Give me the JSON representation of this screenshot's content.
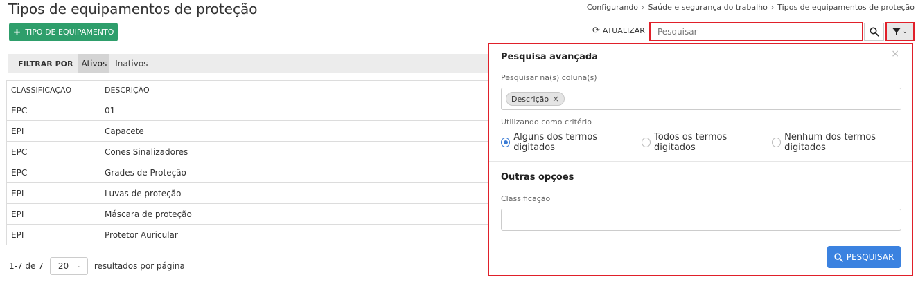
{
  "page": {
    "title": "Tipos de equipamentos de proteção",
    "breadcrumb": [
      "Configurando",
      "Saúde e segurança do trabalho",
      "Tipos de equipamentos de proteção"
    ]
  },
  "toolbar": {
    "add_label": "TIPO DE EQUIPAMENTO",
    "refresh_label": "ATUALIZAR",
    "search_placeholder": "Pesquisar"
  },
  "filter": {
    "label": "FILTRAR POR",
    "options": [
      "Ativos",
      "Inativos"
    ],
    "active": "Ativos"
  },
  "table": {
    "columns": [
      "CLASSIFICAÇÃO",
      "DESCRIÇÃO"
    ],
    "rows": [
      [
        "EPC",
        "01"
      ],
      [
        "EPI",
        "Capacete"
      ],
      [
        "EPC",
        "Cones Sinalizadores"
      ],
      [
        "EPC",
        "Grades de Proteção"
      ],
      [
        "EPI",
        "Luvas de proteção"
      ],
      [
        "EPI",
        "Máscara de proteção"
      ],
      [
        "EPI",
        "Protetor Auricular"
      ]
    ]
  },
  "pager": {
    "range": "1-7 de 7",
    "page_size": "20",
    "suffix": "resultados por página"
  },
  "advanced": {
    "title": "Pesquisa avançada",
    "columns_label": "Pesquisar na(s) coluna(s)",
    "selected_tag": "Descrição",
    "criteria_label": "Utilizando como critério",
    "criteria": [
      "Alguns dos termos digitados",
      "Todos os termos digitados",
      "Nenhum dos termos digitados"
    ],
    "criteria_selected": "Alguns dos termos digitados",
    "other_title": "Outras opções",
    "classification_label": "Classificação",
    "search_button": "PESQUISAR"
  },
  "colors": {
    "accent_green": "#2e9e6b",
    "accent_blue": "#3b82e0",
    "highlight_red": "#e0202a"
  }
}
